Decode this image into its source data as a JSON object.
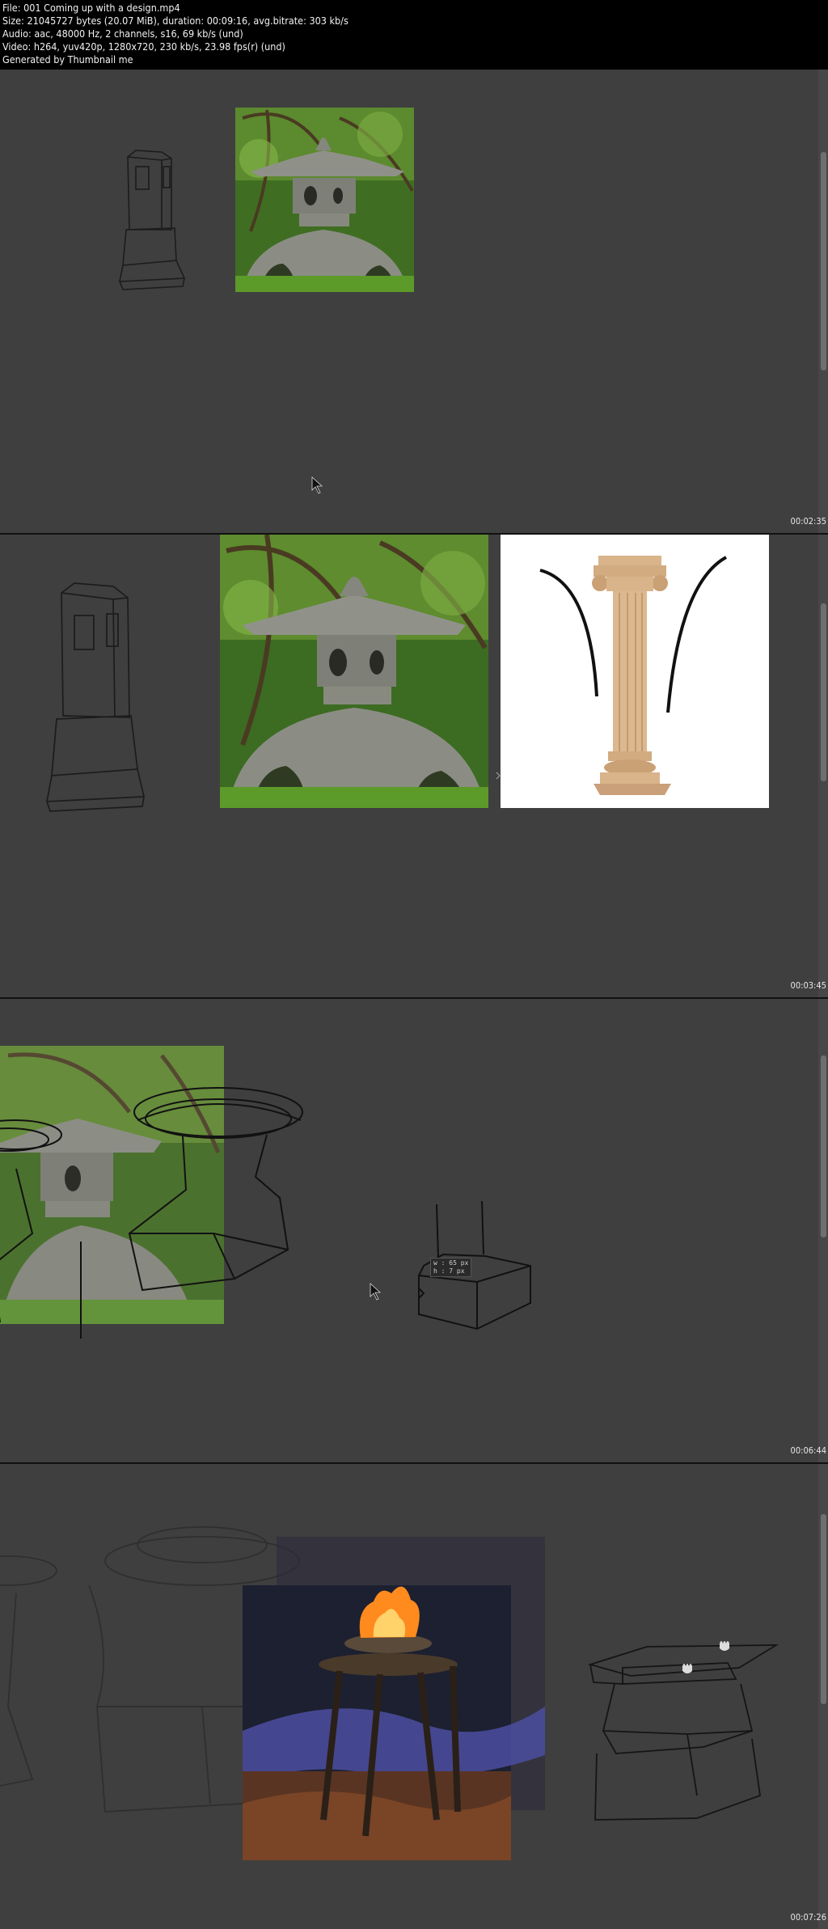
{
  "header": {
    "line1": "File: 001 Coming up with a design.mp4",
    "line2": "Size: 21045727 bytes (20.07 MiB), duration: 00:09:16, avg.bitrate: 303 kb/s",
    "line3": "Audio: aac, 48000 Hz, 2 channels, s16, 69 kb/s (und)",
    "line4": "Video: h264, yuv420p, 1280x720, 230 kb/s, 23.98 fps(r) (und)",
    "line5": "Generated by Thumbnail me"
  },
  "frames": [
    {
      "timestamp": "00:02:35"
    },
    {
      "timestamp": "00:03:45"
    },
    {
      "timestamp": "00:06:44",
      "tooltip_w": "w : 65 px",
      "tooltip_h": "h : 7 px"
    },
    {
      "timestamp": "00:07:26"
    }
  ],
  "colors": {
    "canvas": "#3f3f3f",
    "sketch_line": "#1e1e1e",
    "foliage": "#4f8a2a",
    "stone": "#8d8f86",
    "column": "#d9b48a",
    "fire": "#ff8a1e"
  }
}
